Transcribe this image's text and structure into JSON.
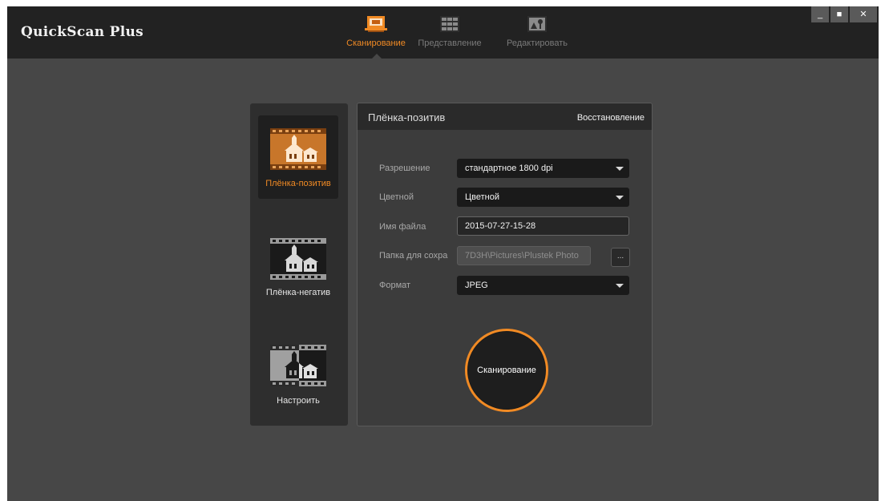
{
  "app": {
    "title": "QuickScan Plus",
    "accent_color": "#f08a24"
  },
  "nav": {
    "tabs": [
      {
        "label": "Сканирование",
        "icon": "scanner-icon",
        "active": true
      },
      {
        "label": "Представление",
        "icon": "grid-view-icon",
        "active": false
      },
      {
        "label": "Редактировать",
        "icon": "edit-image-icon",
        "active": false
      }
    ]
  },
  "window_controls": {
    "minimize": "_",
    "maximize": "■",
    "close": "✕"
  },
  "modes": [
    {
      "label": "Плёнка-позитив",
      "icon": "film-positive-icon",
      "selected": true
    },
    {
      "label": "Плёнка-негатив",
      "icon": "film-negative-icon",
      "selected": false
    },
    {
      "label": "Настроить",
      "icon": "film-custom-icon",
      "selected": false
    }
  ],
  "settings": {
    "title": "Плёнка-позитив",
    "restore_label": "Восстановление",
    "resolution": {
      "label": "Разрешение",
      "value": "стандартное 1800 dpi"
    },
    "color": {
      "label": "Цветной",
      "value": "Цветной"
    },
    "filename": {
      "label": "Имя файла",
      "value": "2015-07-27-15-28"
    },
    "folder": {
      "label": "Папка для сохра",
      "value": "7D3H\\Pictures\\Plustek Photo",
      "browse_label": "..."
    },
    "format": {
      "label": "Формат",
      "value": "JPEG"
    },
    "scan_button_label": "Сканирование"
  }
}
